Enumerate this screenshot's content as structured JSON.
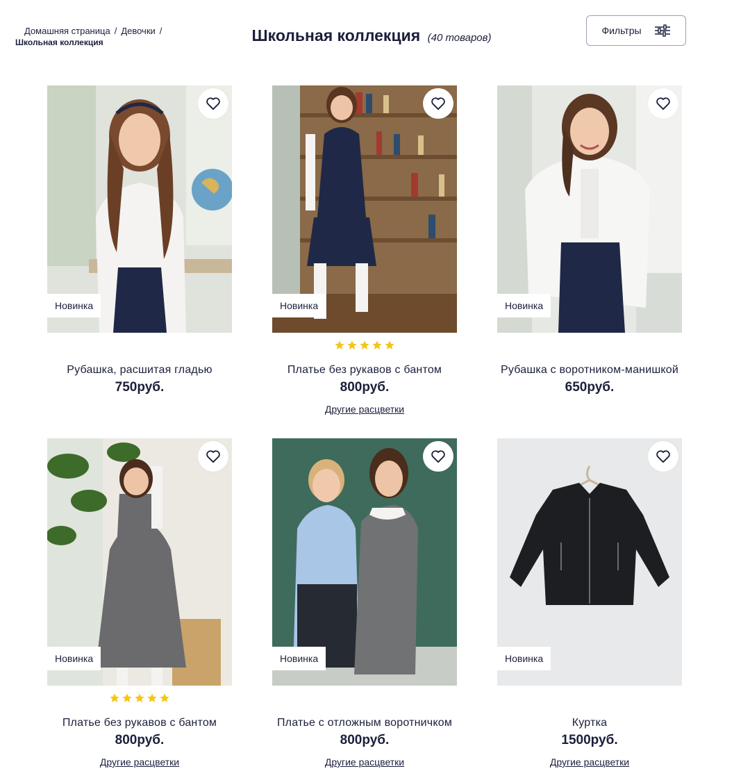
{
  "breadcrumb": {
    "home": "Домашняя страница",
    "girls": "Девочки",
    "current": "Школьная коллекция",
    "separator": "/"
  },
  "header": {
    "title": "Школьная коллекция",
    "count": "(40 товаров)",
    "filters_label": "Фильтры"
  },
  "colors": {
    "text": "#1b1f3b",
    "star": "#f5c518",
    "border": "#9aa0b4"
  },
  "products": [
    {
      "name": "Рубашка, расшитая гладью",
      "price": "750руб.",
      "badge": "Новинка",
      "rating": 0,
      "other_colors": ""
    },
    {
      "name": "Платье без рукавов с бантом",
      "price": "800руб.",
      "badge": "Новинка",
      "rating": 5,
      "other_colors": "Другие расцветки"
    },
    {
      "name": "Рубашка с воротником-манишкой",
      "price": "650руб.",
      "badge": "Новинка",
      "rating": 0,
      "other_colors": ""
    },
    {
      "name": "Платье без рукавов с бантом",
      "price": "800руб.",
      "badge": "Новинка",
      "rating": 5,
      "other_colors": "Другие расцветки"
    },
    {
      "name": "Платье с отложным воротничком",
      "price": "800руб.",
      "badge": "Новинка",
      "rating": 0,
      "other_colors": "Другие расцветки"
    },
    {
      "name": "Куртка",
      "price": "1500руб.",
      "badge": "Новинка",
      "rating": 0,
      "other_colors": "Другие расцветки"
    }
  ]
}
